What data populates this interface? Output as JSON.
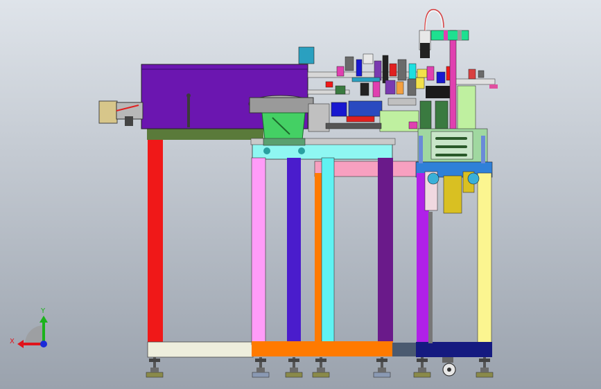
{
  "viewport": {
    "background_top": "#dfe4ea",
    "background_bottom": "#9aa2ad"
  },
  "triad": {
    "x_label": "X",
    "y_label": "Y",
    "x_color": "#e0141c",
    "y_color": "#1bb31b",
    "z_color": "#1a2bd8"
  },
  "colors": {
    "frame_red": "#f01818",
    "frame_pink": "#ff9cf8",
    "frame_blue": "#4a1ccc",
    "frame_orange": "#ff7a00",
    "frame_purple": "#6a1a8a",
    "frame_yellow": "#fbf590",
    "frame_magenta": "#b020e8",
    "frame_navy": "#151a80",
    "housing_purple": "#6b16b0",
    "base_olive": "#5a7a3a",
    "plate_cyan": "#8ff7f2",
    "bowl_green": "#44d064",
    "bar_pink": "#f7a0c0",
    "bar_cyan": "#5ff2f2",
    "foot_olive": "#8a8a4a",
    "foot_steel": "#8a99b3",
    "cream": "#eeeedd",
    "mast_magenta": "#e040b0"
  }
}
